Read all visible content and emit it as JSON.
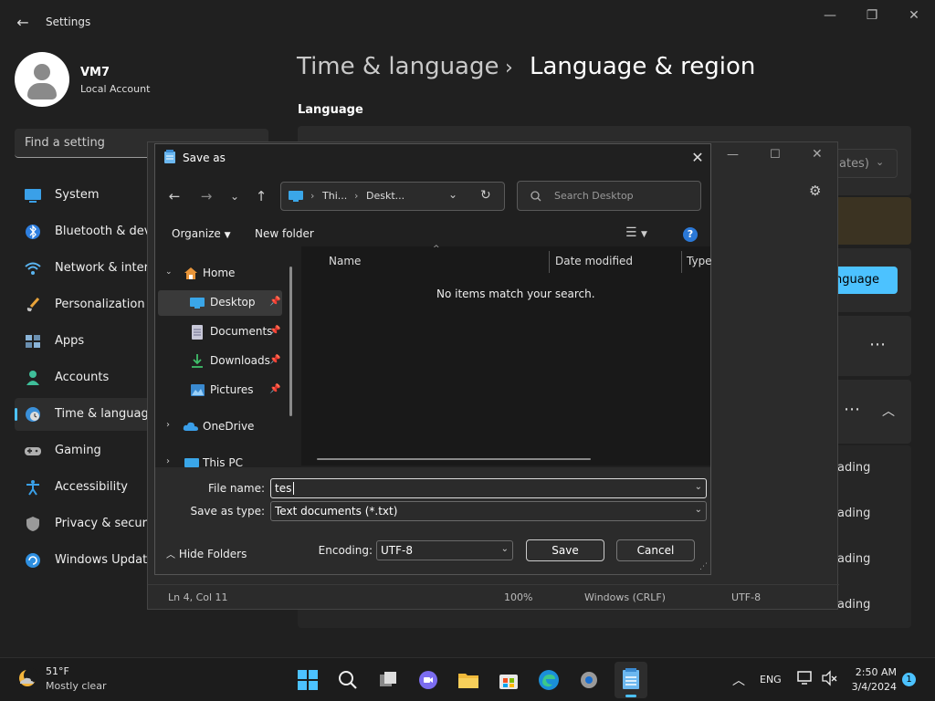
{
  "settings": {
    "app_title": "Settings",
    "user": {
      "name": "VM7",
      "account_type": "Local Account"
    },
    "search_placeholder": "Find a setting",
    "nav": [
      {
        "label": "System",
        "icon": "monitor-icon"
      },
      {
        "label": "Bluetooth & devices",
        "icon": "bluetooth-icon"
      },
      {
        "label": "Network & internet",
        "icon": "wifi-icon"
      },
      {
        "label": "Personalization",
        "icon": "brush-icon"
      },
      {
        "label": "Apps",
        "icon": "apps-icon"
      },
      {
        "label": "Accounts",
        "icon": "person-icon"
      },
      {
        "label": "Time & language",
        "icon": "clock-globe-icon",
        "selected": true
      },
      {
        "label": "Gaming",
        "icon": "gamepad-icon"
      },
      {
        "label": "Accessibility",
        "icon": "accessibility-icon"
      },
      {
        "label": "Privacy & security",
        "icon": "shield-icon"
      },
      {
        "label": "Windows Update",
        "icon": "update-icon"
      }
    ],
    "breadcrumb_parent": "Time & language",
    "breadcrumb_current": "Language & region",
    "section_language": "Language",
    "partial": {
      "dropdown_fragment": "ates)",
      "add_language_fragment": "nguage",
      "downloading_fragment": "ading"
    }
  },
  "notepad": {
    "status": {
      "position": "Ln 4, Col 11",
      "zoom": "100%",
      "line_ending": "Windows (CRLF)",
      "encoding": "UTF-8"
    }
  },
  "dialog": {
    "title": "Save as",
    "address": {
      "part1": "Thi...",
      "part2": "Deskt..."
    },
    "search_placeholder": "Search Desktop",
    "toolbar": {
      "organize": "Organize",
      "new_folder": "New folder"
    },
    "tree": [
      {
        "label": "Home",
        "icon": "home-icon"
      },
      {
        "label": "Desktop",
        "icon": "desktop-folder-icon",
        "pinned": true,
        "selected": true
      },
      {
        "label": "Documents",
        "icon": "documents-icon",
        "pinned": true
      },
      {
        "label": "Downloads",
        "icon": "downloads-icon",
        "pinned": true
      },
      {
        "label": "Pictures",
        "icon": "pictures-icon",
        "pinned": true
      },
      {
        "label": "OneDrive",
        "icon": "cloud-icon"
      },
      {
        "label": "This PC",
        "icon": "pc-icon"
      }
    ],
    "columns": {
      "name": "Name",
      "date_modified": "Date modified",
      "type": "Type"
    },
    "empty_message": "No items match your search.",
    "file_name_label": "File name:",
    "file_name_value": "tes",
    "save_as_type_label": "Save as type:",
    "save_as_type_value": "Text documents (*.txt)",
    "encoding_label": "Encoding:",
    "encoding_value": "UTF-8",
    "hide_folders": "Hide Folders",
    "save": "Save",
    "cancel": "Cancel"
  },
  "taskbar": {
    "weather": {
      "temp": "51°F",
      "condition": "Mostly clear"
    },
    "language": "ENG",
    "time": "2:50 AM",
    "date": "3/4/2024",
    "notification_count": "1"
  }
}
